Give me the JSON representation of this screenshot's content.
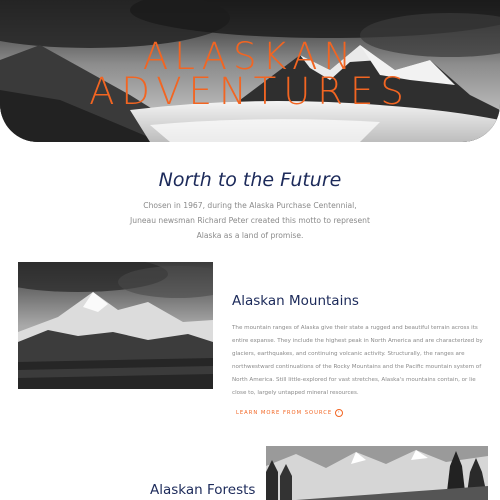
{
  "hero": {
    "title_line1": "ALASKAN",
    "title_line2": "ADVENTURES",
    "image_icon": "mountain-photo"
  },
  "intro": {
    "title": "North to the Future",
    "text": "Chosen in 1967, during the Alaska Purchase Centennial, Juneau newsman Richard Peter created this motto to represent Alaska as a land of promise."
  },
  "mountains": {
    "title": "Alaskan Mountains",
    "body": "The mountain ranges of Alaska give their state a rugged and beautiful terrain across its entire expanse. They include the highest peak in North America and are characterized by glaciers, earthquakes, and continuing volcanic activity. Structurally, the ranges are northwestward continuations of the Rocky Mountains and the Pacific mountain system of North America. Still little-explored for vast stretches, Alaska's mountains contain, or lie close to, largely untapped mineral resources.",
    "link_label": "LEARN MORE FROM SOURCE",
    "link_icon": "arrow-right-circle-icon"
  },
  "forests": {
    "title": "Alaskan Forests"
  },
  "colors": {
    "accent": "#f26522",
    "heading": "#1c2a5a",
    "body_text": "#8a8a8a"
  }
}
